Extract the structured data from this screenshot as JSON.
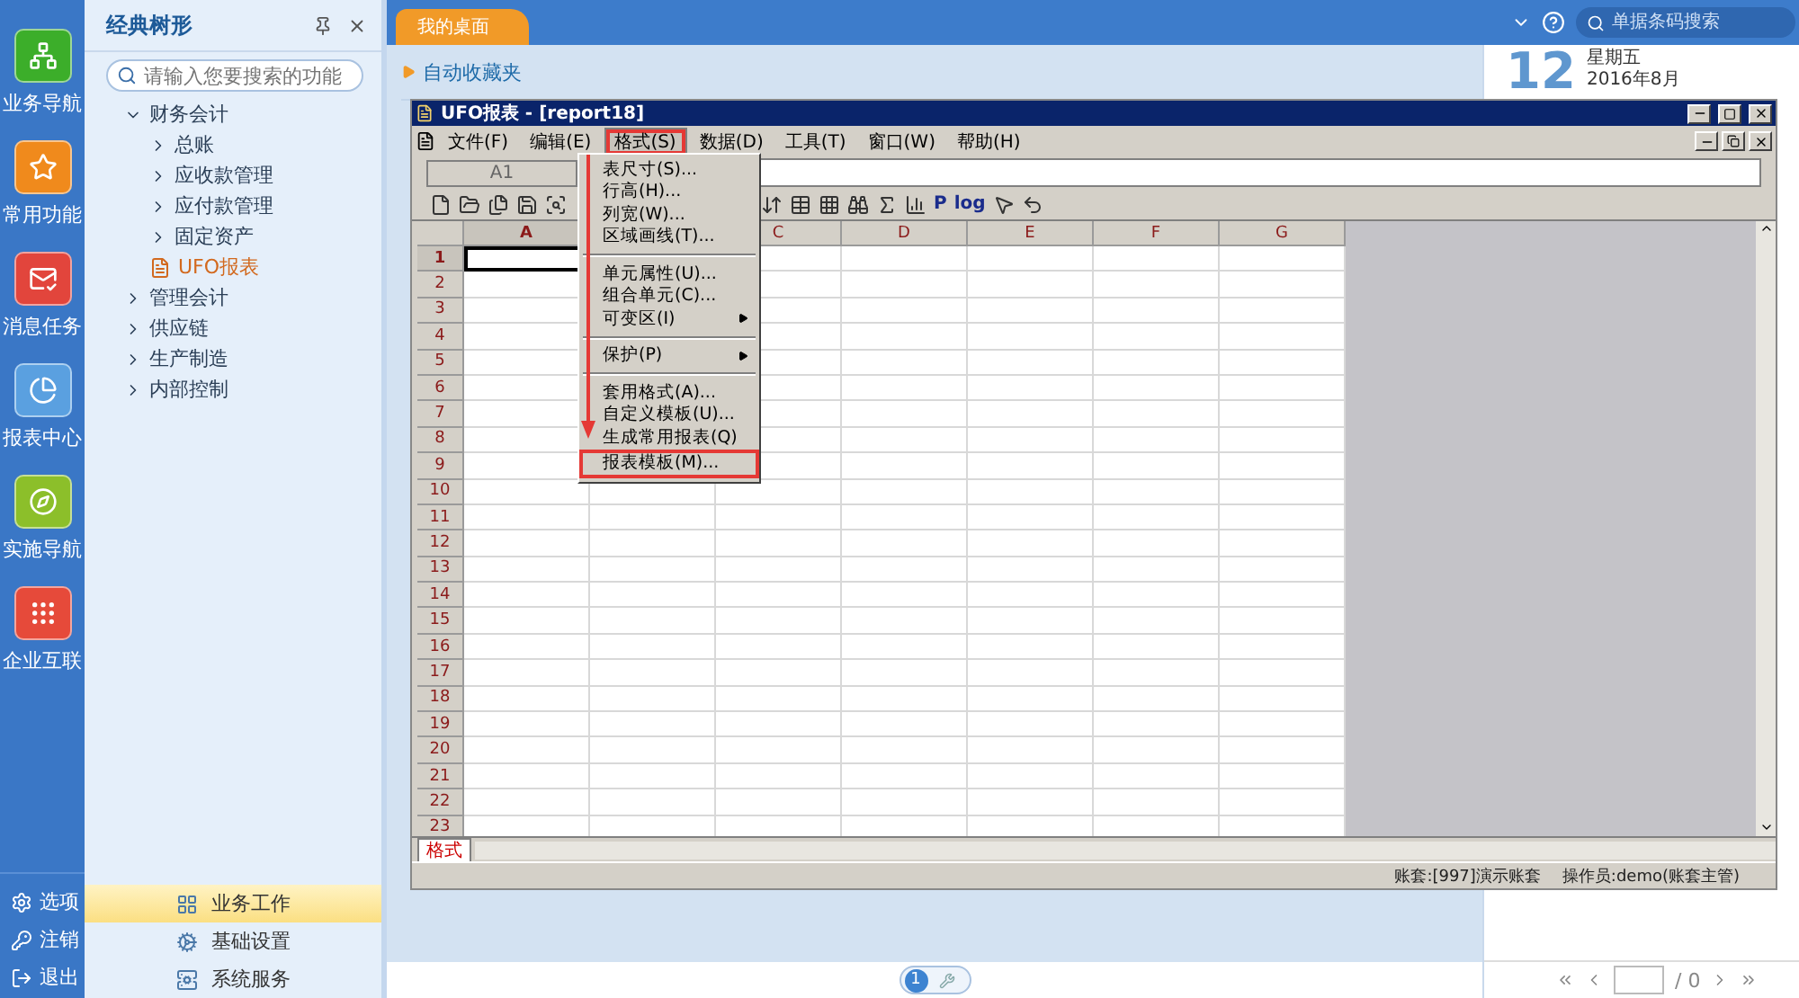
{
  "top_bar": {
    "tab": "我的桌面",
    "search": {
      "placeholder": "单据条码搜索"
    }
  },
  "nav_rail": {
    "items": [
      {
        "label": "业务导航",
        "color": "#3cae2a"
      },
      {
        "label": "常用功能",
        "color": "#f08a1c"
      },
      {
        "label": "消息任务",
        "color": "#e2453c"
      },
      {
        "label": "报表中心",
        "color": "#5aa0e0"
      },
      {
        "label": "实施导航",
        "color": "#8cbf2a"
      },
      {
        "label": "企业互联",
        "color": "#e64a3a"
      }
    ],
    "footer": [
      {
        "label": "选项"
      },
      {
        "label": "注销"
      },
      {
        "label": "退出"
      }
    ]
  },
  "tree_panel": {
    "title": "经典树形",
    "search": {
      "placeholder": "请输入您要搜索的功能"
    },
    "nodes": [
      {
        "label": "财务会计",
        "expanded": true,
        "selected": false,
        "children": [
          {
            "label": "总账",
            "expanded": false,
            "selected": false
          },
          {
            "label": "应收款管理",
            "expanded": false,
            "selected": false
          },
          {
            "label": "应付款管理",
            "expanded": false,
            "selected": false
          },
          {
            "label": "固定资产",
            "expanded": false,
            "selected": false
          },
          {
            "label": "UFO报表",
            "kind": "leaf",
            "selected": true
          }
        ]
      },
      {
        "label": "管理会计",
        "expanded": false,
        "selected": false
      },
      {
        "label": "供应链",
        "expanded": false,
        "selected": false
      },
      {
        "label": "生产制造",
        "expanded": false,
        "selected": false
      },
      {
        "label": "内部控制",
        "expanded": false,
        "selected": false
      }
    ],
    "modules": [
      {
        "label": "业务工作",
        "selected": true
      },
      {
        "label": "基础设置",
        "selected": false
      },
      {
        "label": "系统服务",
        "selected": false
      }
    ]
  },
  "desktop": {
    "favorites": "自动收藏夹",
    "page": "1"
  },
  "calendar": {
    "day": "12",
    "weekday": "星期五",
    "month": "2016年8月",
    "pager_total": "/ 0"
  },
  "ufo_window": {
    "title": "UFO报表 - [report18]",
    "menus": [
      {
        "label": "文件(F)",
        "selected": false,
        "highlighted": false
      },
      {
        "label": "编辑(E)",
        "selected": false,
        "highlighted": false
      },
      {
        "label": "格式(S)",
        "selected": true,
        "highlighted": true
      },
      {
        "label": "数据(D)",
        "selected": false,
        "highlighted": false
      },
      {
        "label": "工具(T)",
        "selected": false,
        "highlighted": false
      },
      {
        "label": "窗口(W)",
        "selected": false,
        "highlighted": false
      },
      {
        "label": "帮助(H)",
        "selected": false,
        "highlighted": false
      }
    ],
    "format_menu": [
      [
        {
          "label": "表尺寸(S)...",
          "submenu": false,
          "highlighted": false
        },
        {
          "label": "行高(H)...",
          "submenu": false,
          "highlighted": false
        },
        {
          "label": "列宽(W)...",
          "submenu": false,
          "highlighted": false
        },
        {
          "label": "区域画线(T)...",
          "submenu": false,
          "highlighted": false
        }
      ],
      [
        {
          "label": "单元属性(U)...",
          "submenu": false,
          "highlighted": false
        },
        {
          "label": "组合单元(C)...",
          "submenu": false,
          "highlighted": false
        },
        {
          "label": "可变区(I)",
          "submenu": true,
          "highlighted": false
        }
      ],
      [
        {
          "label": "保护(P)",
          "submenu": true,
          "highlighted": false
        }
      ],
      [
        {
          "label": "套用格式(A)...",
          "submenu": false,
          "highlighted": false
        },
        {
          "label": "自定义模板(U)...",
          "submenu": false,
          "highlighted": false
        },
        {
          "label": "生成常用报表(Q)",
          "submenu": false,
          "highlighted": false
        },
        {
          "label": "报表模板(M)...",
          "submenu": false,
          "highlighted": true
        }
      ]
    ],
    "cell_ref": "A1",
    "toolbar_text": [
      "P",
      "log"
    ],
    "columns": [
      {
        "label": "A",
        "selected": true
      },
      {
        "kind": "hidden"
      },
      {
        "label": "C",
        "selected": false
      },
      {
        "label": "D",
        "selected": false
      },
      {
        "label": "E",
        "selected": false
      },
      {
        "label": "F",
        "selected": false
      },
      {
        "label": "G",
        "selected": false
      }
    ],
    "rows": [
      {
        "label": "1",
        "selected": true
      },
      {
        "label": "2",
        "selected": false
      },
      {
        "label": "3",
        "selected": false
      },
      {
        "label": "4",
        "selected": false
      },
      {
        "label": "5",
        "selected": false
      },
      {
        "label": "6",
        "selected": false
      },
      {
        "label": "7",
        "selected": false
      },
      {
        "label": "8",
        "selected": false
      },
      {
        "label": "9",
        "selected": false
      },
      {
        "label": "10",
        "selected": false
      },
      {
        "label": "11",
        "selected": false
      },
      {
        "label": "12",
        "selected": false
      },
      {
        "label": "13",
        "selected": false
      },
      {
        "label": "14",
        "selected": false
      },
      {
        "label": "15",
        "selected": false
      },
      {
        "label": "16",
        "selected": false
      },
      {
        "label": "17",
        "selected": false
      },
      {
        "label": "18",
        "selected": false
      },
      {
        "label": "19",
        "selected": false
      },
      {
        "label": "20",
        "selected": false
      },
      {
        "label": "21",
        "selected": false
      },
      {
        "label": "22",
        "selected": false
      },
      {
        "label": "23",
        "selected": false
      }
    ],
    "sheet_tab": "格式",
    "status": [
      "账套:[997]演示账套",
      "操作员:demo(账套主管)"
    ]
  }
}
